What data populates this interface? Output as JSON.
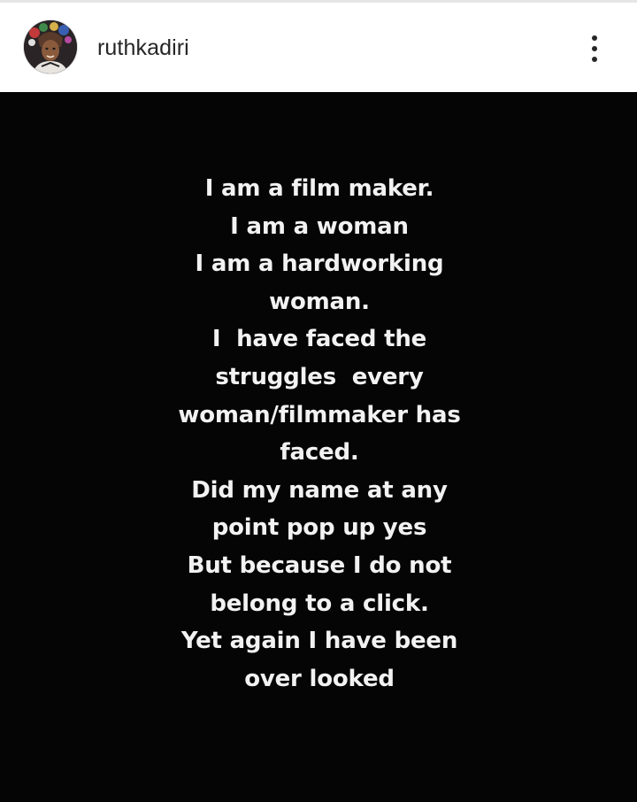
{
  "header": {
    "username": "ruthkadiri",
    "avatar_icon": "profile-photo-avatar",
    "more_icon": "vertical-ellipsis-icon"
  },
  "post": {
    "background_color": "#050505",
    "text_color": "#f2f2f2",
    "lines": [
      "I am a film maker.",
      "I am a woman",
      "I am a hardworking",
      "woman.",
      "I  have faced the",
      "struggles  every",
      "woman/filmmaker has",
      "faced.",
      "Did my name at any",
      "point pop up yes",
      "But because I do not",
      "belong to a click.",
      "Yet again I have been",
      "over looked"
    ]
  }
}
